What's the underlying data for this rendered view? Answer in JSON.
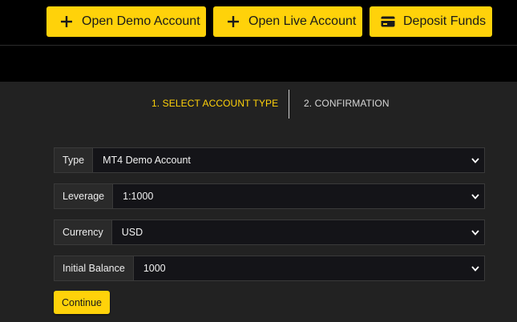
{
  "header": {
    "buttons": [
      {
        "label": "Open Demo Account",
        "icon": "plus-icon"
      },
      {
        "label": "Open Live Account",
        "icon": "plus-icon"
      },
      {
        "label": "Deposit Funds",
        "icon": "credit-card-icon"
      }
    ]
  },
  "steps": [
    {
      "label": "1. SELECT ACCOUNT TYPE",
      "active": true
    },
    {
      "label": "2. CONFIRMATION",
      "active": false
    }
  ],
  "form": {
    "fields": [
      {
        "label": "Type",
        "value": "MT4 Demo Account"
      },
      {
        "label": "Leverage",
        "value": "1:1000"
      },
      {
        "label": "Currency",
        "value": "USD"
      },
      {
        "label": "Initial Balance",
        "value": "1000"
      }
    ],
    "submit_label": "Continue"
  },
  "colors": {
    "accent": "#ffd20a",
    "background": "#000000",
    "panel": "#222222"
  }
}
